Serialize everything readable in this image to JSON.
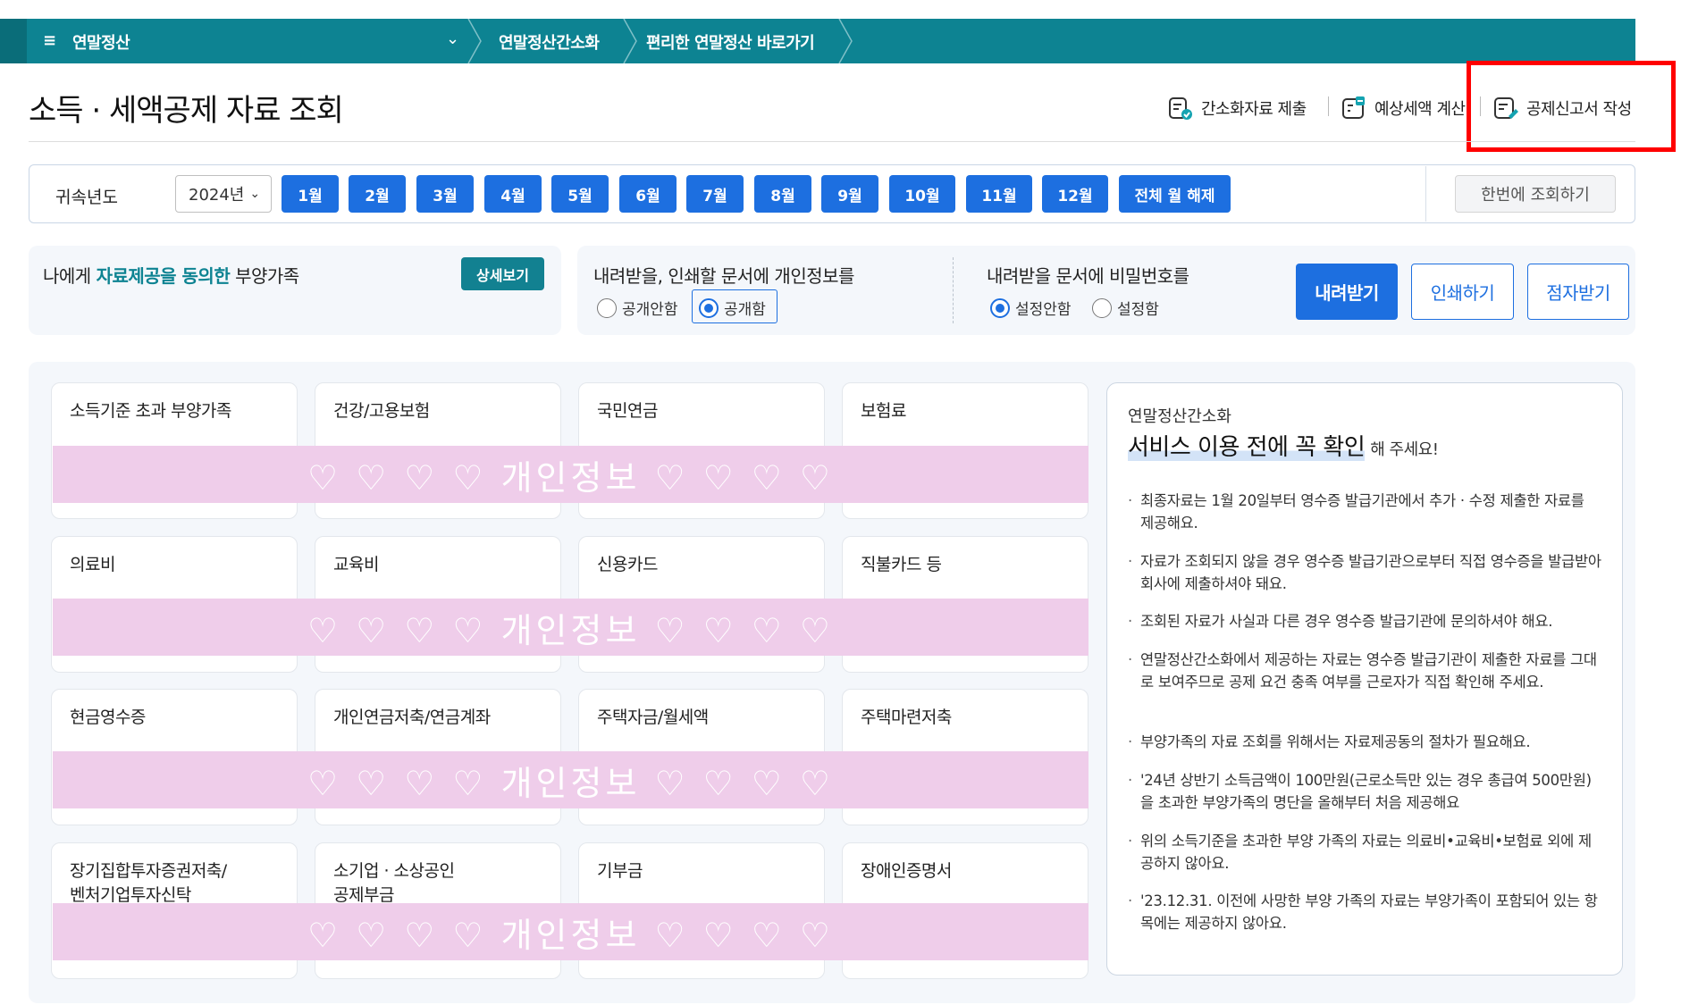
{
  "nav": {
    "menu_icon": "hamburger-icon",
    "title": "연말정산",
    "crumbs": [
      "연말정산간소화",
      "편리한 연말정산 바로가기"
    ]
  },
  "header": {
    "title": "소득 · 세액공제 자료 조회",
    "actions": [
      "간소화자료 제출",
      "예상세액 계산",
      "공제신고서 작성"
    ]
  },
  "filter": {
    "year_label": "귀속년도",
    "year_value": "2024년",
    "months": [
      "1월",
      "2월",
      "3월",
      "4월",
      "5월",
      "6월",
      "7월",
      "8월",
      "9월",
      "10월",
      "11월",
      "12월",
      "전체 월 해제"
    ],
    "query_button": "한번에 조회하기"
  },
  "consent": {
    "prefix": "나에게 ",
    "highlight": "자료제공을 동의한",
    "suffix": " 부양가족",
    "detail_button": "상세보기"
  },
  "privacy_option": {
    "title": "내려받을, 인쇄할 문서에 개인정보를",
    "options": [
      "공개안함",
      "공개함"
    ],
    "selected": "공개함"
  },
  "password_option": {
    "title": "내려받을 문서에 비밀번호를",
    "options": [
      "설정안함",
      "설정함"
    ],
    "selected": "설정안함"
  },
  "actions": {
    "download": "내려받기",
    "print": "인쇄하기",
    "braille": "점자받기"
  },
  "cards": [
    [
      "소득기준 초과 부양가족",
      "건강/고용보험",
      "국민연금",
      "보험료"
    ],
    [
      "의료비",
      "교육비",
      "신용카드",
      "직불카드 등"
    ],
    [
      "현금영수증",
      "개인연금저축/연금계좌",
      "주택자금/월세액",
      "주택마련저축"
    ],
    [
      "장기집합투자증권저축/\n벤처기업투자신탁",
      "소기업 · 소상공인\n공제부금",
      "기부금",
      "장애인증명서"
    ]
  ],
  "mask_text": "♡ ♡ ♡ ♡ 개인정보 ♡ ♡ ♡ ♡",
  "notice": {
    "subtitle": "연말정산간소화",
    "title_em": "서비스 이용 전에 꼭 확인",
    "title_tail": "해 주세요!",
    "items": [
      "최종자료는 1월 20일부터 영수증 발급기관에서 추가 · 수정 제출한 자료를 제공해요.",
      "자료가 조회되지 않을 경우 영수증 발급기관으로부터 직접 영수증을 발급받아 회사에 제출하셔야 돼요.",
      "조회된 자료가 사실과 다른 경우 영수증 발급기관에 문의하셔야 해요.",
      "연말정산간소화에서 제공하는 자료는 영수증 발급기관이 제출한 자료를 그대로 보여주므로 공제 요건 충족 여부를 근로자가 직접 확인해 주세요.",
      "부양가족의 자료 조회를 위해서는 자료제공동의 절차가 필요해요.",
      "'24년 상반기 소득금액이 100만원(근로소득만 있는 경우 총급여 500만원)을 초과한 부양가족의 명단을 올해부터 처음 제공해요",
      "위의 소득기준을 초과한 부양 가족의 자료는 의료비•교육비•보험료 외에 제공하지 않아요.",
      "'23.12.31. 이전에 사망한 부양 가족의 자료는 부양가족이 포함되어 있는 항목에는 제공하지 않아요."
    ]
  },
  "colors": {
    "nav_teal": "#0d8392",
    "primary_blue": "#1d6fe0",
    "mask_pink": "#efcdea",
    "highlight_red": "#ff0000"
  }
}
